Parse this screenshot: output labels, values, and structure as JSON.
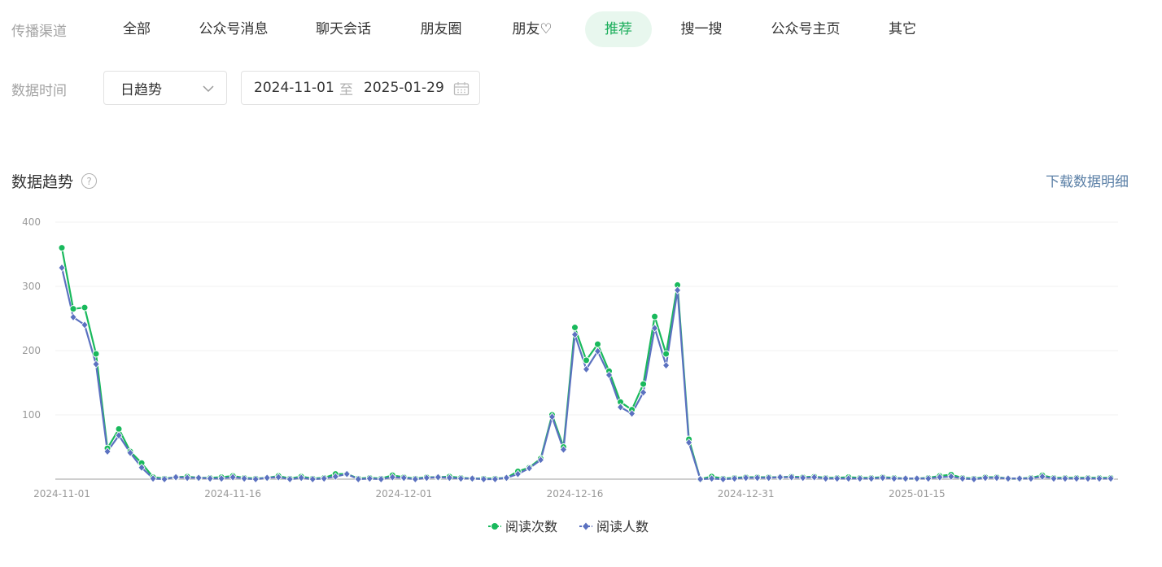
{
  "filters": {
    "channel_label": "传播渠道",
    "channels": [
      "全部",
      "公众号消息",
      "聊天会话",
      "朋友圈",
      "朋友♡",
      "推荐",
      "搜一搜",
      "公众号主页",
      "其它"
    ],
    "active_channel": "推荐",
    "time_label": "数据时间",
    "granularity": "日趋势",
    "date_start": "2024-11-01",
    "date_sep": "至",
    "date_end": "2025-01-29"
  },
  "section": {
    "title": "数据趋势",
    "help": "?",
    "download": "下载数据明细"
  },
  "colors": {
    "accent": "#1aad5a",
    "series_reads": "#19b95c",
    "series_readers": "#5b71c0",
    "link": "#5a7fa6"
  },
  "chart_data": {
    "type": "line",
    "x_start": "2024-11-01",
    "x_end": "2025-01-29",
    "x_tick_labels": [
      "2024-11-01",
      "2024-11-16",
      "2024-12-01",
      "2024-12-16",
      "2024-12-31",
      "2025-01-15"
    ],
    "y_ticks": [
      100,
      200,
      300,
      400
    ],
    "ylim": [
      0,
      400
    ],
    "grid": true,
    "legend_position": "bottom",
    "series": [
      {
        "name": "阅读次数",
        "marker": "circle",
        "values": [
          360,
          265,
          267,
          195,
          48,
          78,
          43,
          25,
          3,
          1,
          3,
          4,
          2,
          2,
          3,
          5,
          2,
          1,
          2,
          5,
          1,
          4,
          1,
          2,
          8,
          8,
          1,
          2,
          1,
          6,
          3,
          1,
          3,
          3,
          4,
          2,
          1,
          1,
          1,
          2,
          12,
          18,
          32,
          100,
          50,
          236,
          185,
          210,
          168,
          120,
          108,
          148,
          253,
          195,
          302,
          62,
          0,
          4,
          1,
          2,
          3,
          3,
          3,
          3,
          4,
          3,
          4,
          2,
          2,
          3,
          2,
          2,
          3,
          2,
          1,
          1,
          2,
          5,
          7,
          2,
          1,
          3,
          3,
          1,
          1,
          2,
          6,
          2,
          2,
          2,
          2,
          2,
          2
        ]
      },
      {
        "name": "阅读人数",
        "marker": "diamond",
        "values": [
          329,
          252,
          240,
          179,
          43,
          68,
          41,
          18,
          1,
          0,
          3,
          2,
          2,
          1,
          1,
          3,
          1,
          0,
          2,
          3,
          0,
          2,
          0,
          1,
          4,
          8,
          0,
          1,
          0,
          3,
          2,
          0,
          2,
          3,
          2,
          1,
          1,
          0,
          0,
          2,
          8,
          17,
          30,
          97,
          46,
          225,
          171,
          199,
          162,
          112,
          102,
          135,
          235,
          177,
          294,
          57,
          0,
          1,
          0,
          1,
          2,
          2,
          2,
          3,
          3,
          2,
          3,
          1,
          1,
          1,
          1,
          1,
          2,
          1,
          1,
          1,
          1,
          3,
          4,
          1,
          0,
          2,
          2,
          1,
          1,
          1,
          4,
          1,
          1,
          1,
          1,
          1,
          1
        ]
      }
    ]
  }
}
